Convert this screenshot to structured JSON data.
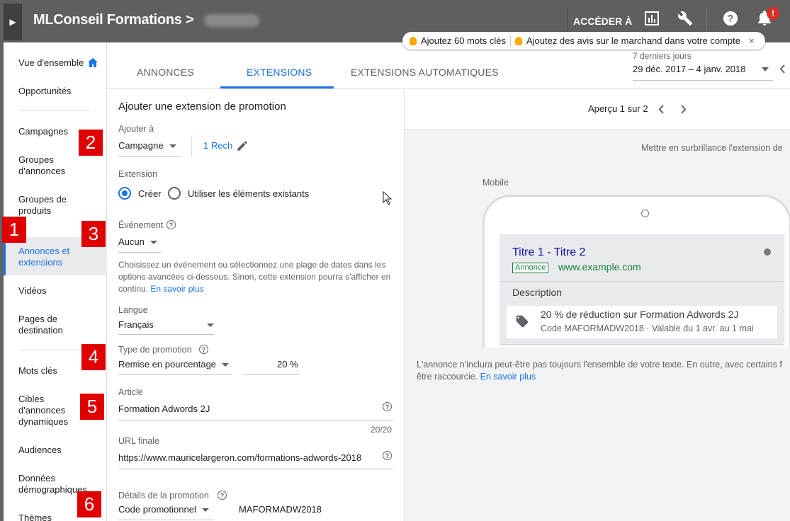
{
  "topbar": {
    "brand": "MLConseil Formations",
    "crumb_separator": ">",
    "goto_label": "ACCÉDER À",
    "notif_count": "!",
    "icons": [
      "reports-icon",
      "tools-wrench-icon",
      "help-icon",
      "notifications-bell-icon"
    ]
  },
  "suggestions": {
    "item1": "Ajoutez 60 mots clés",
    "item2": "Ajoutez des avis sur le marchand dans votre compte",
    "close": "×"
  },
  "leftnav": {
    "items": [
      "Vue d'ensemble",
      "Opportunités",
      "Campagnes",
      "Groupes d'annonces",
      "Groupes de produits",
      "Annonces et extensions",
      "Vidéos",
      "Pages de destination",
      "Mots clés",
      "Cibles d'annonces dynamiques",
      "Audiences",
      "Données démographiques",
      "Thèmes"
    ],
    "active": "Annonces et extensions"
  },
  "markers": [
    "1",
    "2",
    "3",
    "4",
    "5",
    "6"
  ],
  "tabs": {
    "items": [
      "ANNONCES",
      "EXTENSIONS",
      "EXTENSIONS AUTOMATIQUES"
    ],
    "active": "EXTENSIONS"
  },
  "daterange": {
    "label": "7 derniers jours",
    "value": "29 déc. 2017 – 4 janv. 2018"
  },
  "form": {
    "title": "Ajouter une extension de promotion",
    "add_to_label": "Ajouter à",
    "add_to_value": "Campagne",
    "add_to_link": "1 Rech",
    "extension_label": "Extension",
    "radio_create": "Créer",
    "radio_existing": "Utiliser les éléments existants",
    "event_label": "Événement",
    "event_value": "Aucun",
    "event_help_text": "Choisissez un événement ou sélectionnez une plage de dates dans les options avancées ci-dessous. Sinon, cette extension pourra s'afficher en continu.",
    "event_help_link": "En savoir plus",
    "language_label": "Langue",
    "language_value": "Français",
    "promo_type_label": "Type de promotion",
    "promo_type_value": "Remise en pourcentage",
    "percent_value": "20",
    "percent_unit": "%",
    "article_label": "Article",
    "article_value": "Formation Adwords 2J",
    "article_counter": "20/20",
    "url_label": "URL finale",
    "url_value": "https://www.mauricelargeron.com/formations-adwords-2018",
    "details_label": "Détails de la promotion",
    "details_value": "Code promotionnel",
    "details_code": "MAFORMADW2018"
  },
  "preview": {
    "pager": "Aperçu 1 sur 2",
    "highlight": "Mettre en surbrillance l'extension de",
    "mobile_label": "Mobile",
    "ad_title": "Titre 1 - Titre 2",
    "ad_badge": "Annonce",
    "ad_url": "www.example.com",
    "ad_description": "Description",
    "promo_line1": "20 % de réduction sur Formation Adwords 2J",
    "promo_line2": "Code MAFORMADW2018  ·  Valable du 1 avr. au 1 mai",
    "disclaimer_line1": "L'annonce n'inclura peut-être pas toujours l'ensemble de votre texte. En outre, avec certains f",
    "disclaimer_line2": "être raccourcie.",
    "disclaimer_link": "En savoir plus"
  },
  "colors": {
    "topbar": "#5f5f5f",
    "accent": "#1a73e8",
    "marker": "#e00000",
    "ad_title": "#1a0dab",
    "ad_url": "#188038"
  }
}
